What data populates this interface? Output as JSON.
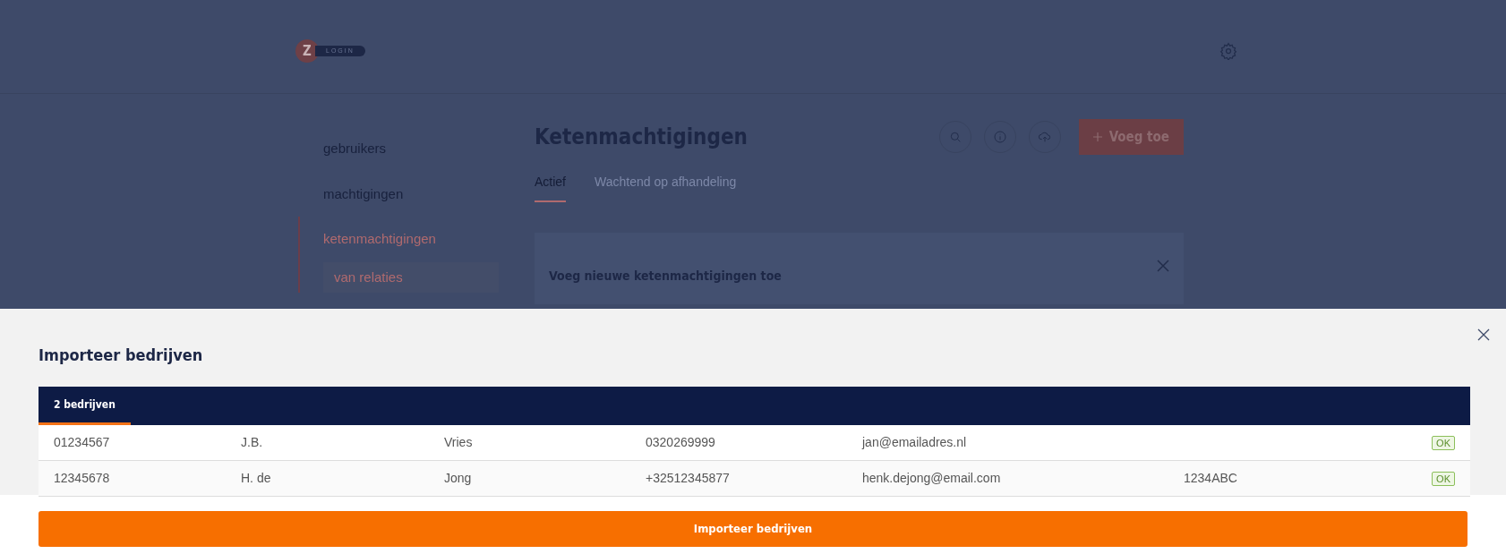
{
  "header": {
    "logo_letter": "Z",
    "logo_text": "LOGIN"
  },
  "sidebar": {
    "items": [
      {
        "label": "gebruikers",
        "selected": false
      },
      {
        "label": "machtigingen",
        "selected": false
      },
      {
        "label": "ketenmachtigingen",
        "selected": true,
        "children": [
          {
            "label": "van relaties",
            "selected": true
          }
        ]
      }
    ]
  },
  "page": {
    "title": "Ketenmachtigingen",
    "add_button": "Voeg toe",
    "tabs": [
      {
        "label": "Actief",
        "selected": true
      },
      {
        "label": "Wachtend op afhandeling",
        "selected": false
      }
    ],
    "card": {
      "title": "Voeg nieuwe ketenmachtigingen toe"
    }
  },
  "modal": {
    "title": "Importeer bedrijven",
    "tab": {
      "label": "2 bedrijven",
      "selected": true
    },
    "rows": [
      {
        "cells": [
          "01234567",
          "J.B.",
          "Vries",
          "0320269999",
          "jan@emailadres.nl",
          ""
        ],
        "status": "OK"
      },
      {
        "cells": [
          "12345678",
          "H. de",
          "Jong",
          "+32512345877",
          "henk.dejong@email.com",
          "1234ABC"
        ],
        "status": "OK"
      }
    ],
    "button": "Importeer bedrijven"
  }
}
